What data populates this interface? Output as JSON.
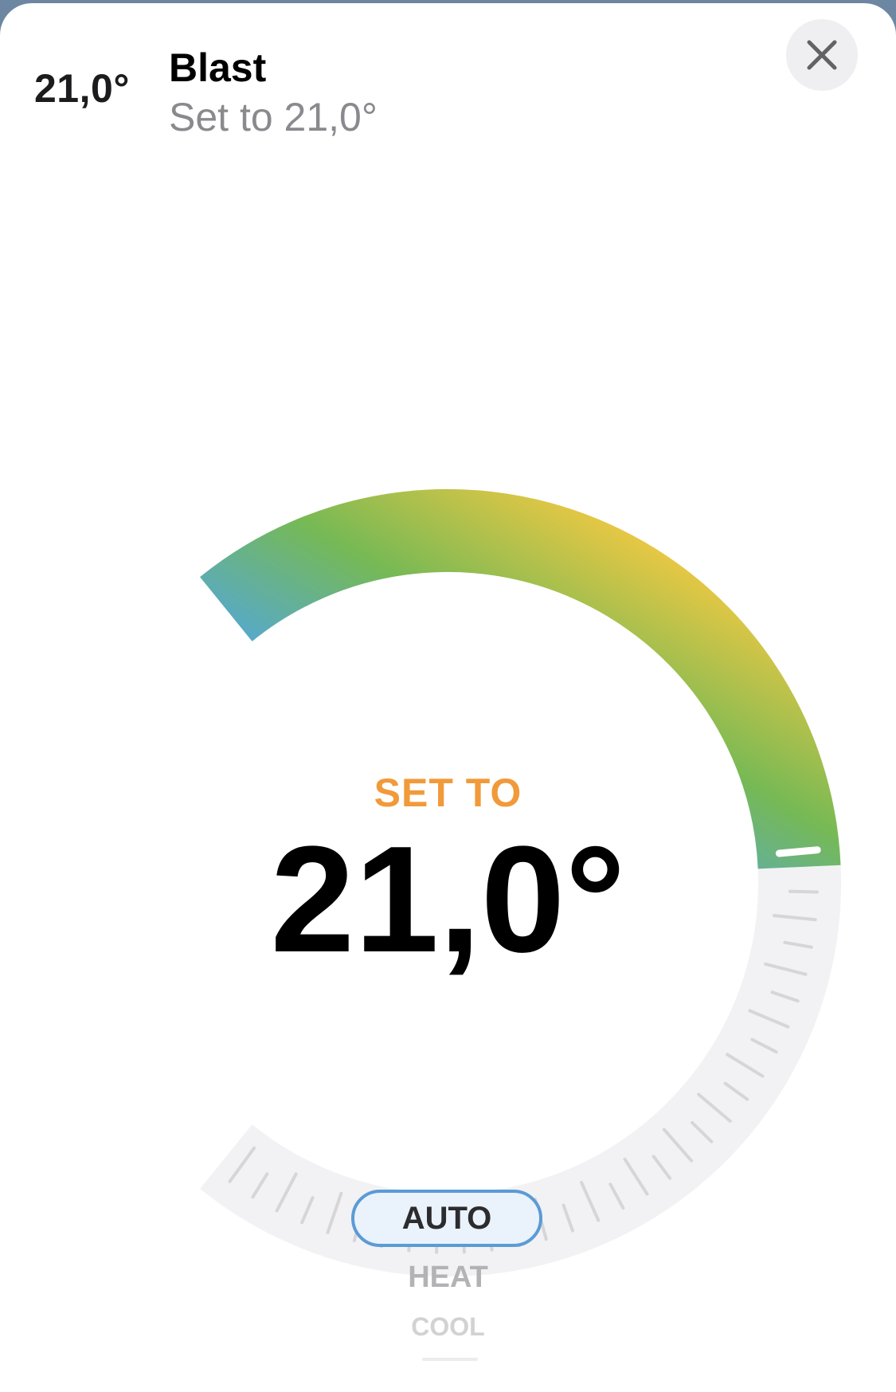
{
  "header": {
    "current_temp": "21,0°",
    "title": "Blast",
    "subtitle": "Set to 21,0°"
  },
  "close_button": {
    "icon": "close-icon"
  },
  "dial": {
    "label": "SET TO",
    "value_text": "21,0°",
    "setpoint_fraction": 0.49,
    "colors": {
      "cold": "#79d9e6",
      "blue": "#52a7dc",
      "green": "#76b955",
      "yellow": "#f4c942",
      "track": "#f2f2f4",
      "tick": "#d6d6d8",
      "label": "#f19a3a"
    }
  },
  "modes": {
    "selected": "AUTO",
    "options": [
      "AUTO",
      "HEAT",
      "COOL"
    ]
  }
}
